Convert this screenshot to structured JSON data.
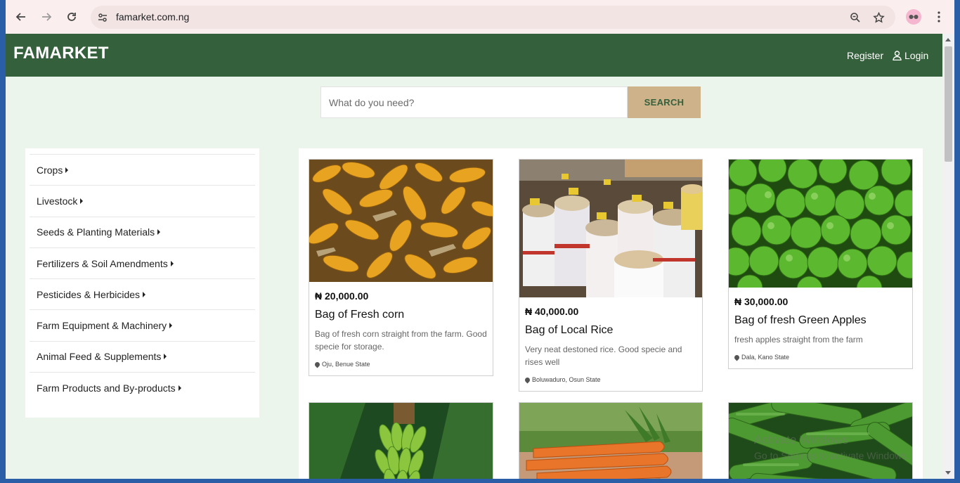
{
  "browser": {
    "url": "famarket.com.ng",
    "profile_color": "#f5b6cf"
  },
  "site": {
    "brand": "FAMARKET",
    "register": "Register",
    "login": "Login",
    "header_color": "#35603c",
    "accent": "#cdb28a"
  },
  "search": {
    "placeholder": "What do you need?",
    "button": "SEARCH"
  },
  "categories": [
    {
      "label": "Crops"
    },
    {
      "label": "Livestock"
    },
    {
      "label": "Seeds & Planting Materials"
    },
    {
      "label": "Fertilizers & Soil Amendments"
    },
    {
      "label": "Pesticides & Herbicides"
    },
    {
      "label": "Farm Equipment & Machinery"
    },
    {
      "label": "Animal Feed & Supplements"
    },
    {
      "label": "Farm Products and By-products"
    }
  ],
  "products": [
    {
      "price": "₦ 20,000.00",
      "title": "Bag of Fresh corn",
      "desc": "Bag of fresh corn straight from the farm. Good specie for storage.",
      "location": "Oju, Benue State",
      "image": "corn"
    },
    {
      "price": "₦ 40,000.00",
      "title": "Bag of Local Rice",
      "desc": "Very neat destoned rice. Good specie and rises well",
      "location": "Boluwaduro, Osun State",
      "image": "rice"
    },
    {
      "price": "₦ 30,000.00",
      "title": "Bag of fresh Green Apples",
      "desc": "fresh apples straight from the farm",
      "location": "Dala, Kano State",
      "image": "apples"
    },
    {
      "image": "bananas"
    },
    {
      "image": "carrots"
    },
    {
      "image": "cucumbers"
    }
  ],
  "watermark": {
    "line1": "Activate Windows",
    "line2": "Go to Settings to activate Windows."
  }
}
